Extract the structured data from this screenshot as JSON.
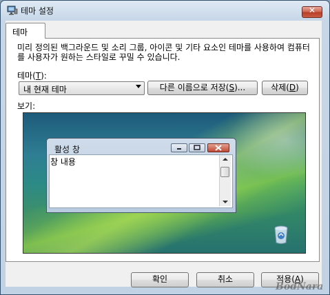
{
  "window": {
    "title": "테마 설정",
    "close_label": "✕"
  },
  "tab": {
    "label": "테마"
  },
  "description": "미리 정의된 백그라운드 및 소리 그룹, 아이콘 및 기타 요소인 테마를 사용하여 컴퓨터를 사용자가 원하는 스타일로 꾸밀 수 있습니다.",
  "theme": {
    "label_prefix": "테마(",
    "label_key": "T",
    "label_suffix": "):",
    "selected": "내 현재 테마"
  },
  "buttons": {
    "save_as_prefix": "다른 이름으로 저장(",
    "save_as_key": "S",
    "save_as_suffix": ")...",
    "delete_prefix": "삭제(",
    "delete_key": "D",
    "delete_suffix": ")",
    "ok": "확인",
    "cancel": "취소",
    "apply_prefix": "적용(",
    "apply_key": "A",
    "apply_suffix": ")"
  },
  "preview": {
    "label": "보기:",
    "window_title": "활성 창",
    "window_text": "창 내용"
  },
  "watermark": "BodNara",
  "icons": [
    "display-settings-icon",
    "close-icon",
    "minimize-icon",
    "maximize-icon",
    "recycle-bin-icon"
  ]
}
